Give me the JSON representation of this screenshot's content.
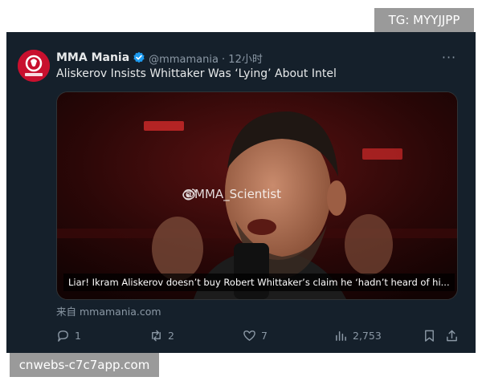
{
  "overlays": {
    "tg_badge": "TG: MYYJJPP",
    "site_badge": "cnwebs-c7c7app.com"
  },
  "tweet": {
    "display_name": "MMA Mania",
    "handle_time": "@mmamania · 12小时",
    "text": "Aliskerov Insists Whittaker Was ‘Lying’ About Intel",
    "more_label": "···",
    "media": {
      "watermark": "@MMA_Scientist",
      "caption": "Liar! Ikram Aliskerov doesn’t buy Robert Whittaker’s claim he ‘hadn’t heard of hi..."
    },
    "source": "来自 mmamania.com",
    "actions": {
      "replies": "1",
      "reposts": "2",
      "likes": "7",
      "views": "2,753"
    }
  },
  "colors": {
    "card_bg": "#15202b",
    "verified_blue": "#1d9bf0",
    "brand_red": "#c8102e"
  },
  "icons": {
    "avatar": "mma-mania-logo",
    "verified": "verified-badge-icon",
    "reply": "reply-icon",
    "repost": "repost-icon",
    "like": "heart-icon",
    "views": "views-chart-icon",
    "bookmark": "bookmark-icon",
    "share": "share-icon"
  }
}
